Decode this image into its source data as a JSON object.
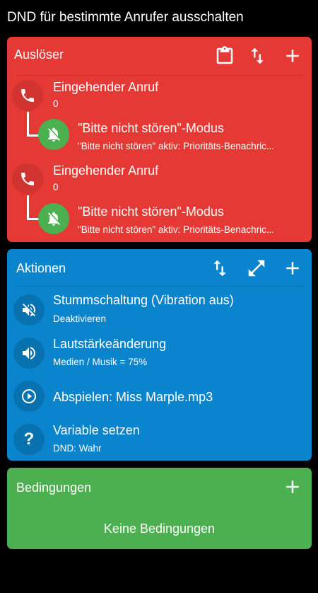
{
  "header": {
    "title": "DND für bestimmte Anrufer ausschalten"
  },
  "triggers": {
    "title": "Auslöser",
    "color": "#e53935",
    "items": [
      {
        "label": "Eingehender Anruf",
        "detail": "0",
        "icon": "phone-icon",
        "constraint": {
          "label": "\"Bitte nicht stören\"-Modus",
          "detail": "\"Bitte nicht stören\" aktiv: Prioritäts-Benachric...",
          "icon": "bell-off-icon"
        }
      },
      {
        "label": "Eingehender Anruf",
        "detail": "0",
        "icon": "phone-icon",
        "constraint": {
          "label": "\"Bitte nicht stören\"-Modus",
          "detail": "\"Bitte nicht stören\" aktiv: Prioritäts-Benachric...",
          "icon": "bell-off-icon"
        }
      }
    ]
  },
  "actions": {
    "title": "Aktionen",
    "color": "#0a84cc",
    "items": [
      {
        "label": "Stummschaltung (Vibration aus)",
        "detail": "Deaktivieren",
        "icon": "volume-off-icon"
      },
      {
        "label": "Lautstärkeänderung",
        "detail": "Medien / Musik = 75%",
        "icon": "volume-up-icon"
      },
      {
        "label": "Abspielen: Miss Marple.mp3",
        "detail": "",
        "icon": "play-circle-icon"
      },
      {
        "label": "Variable setzen",
        "detail": "DND: Wahr",
        "icon": "question-icon",
        "icon_glyph": "?"
      }
    ]
  },
  "conditions": {
    "title": "Bedingungen",
    "color": "#4caf50",
    "empty_text": "Keine Bedingungen"
  }
}
